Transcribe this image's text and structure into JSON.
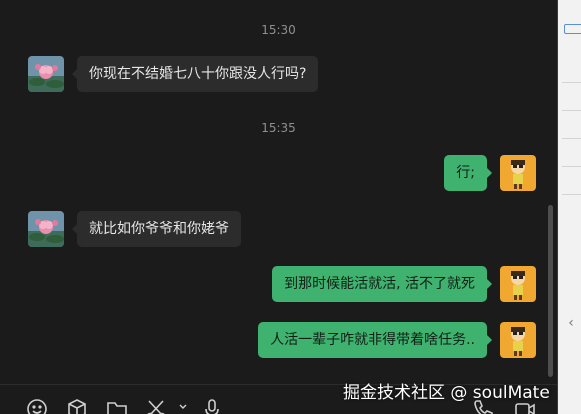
{
  "colors": {
    "background": "#1b1b1b",
    "incoming_bubble": "#2c2c2c",
    "outgoing_bubble": "#3fb270",
    "timestamp_text": "#8f8f8f"
  },
  "timestamps": [
    "15:30",
    "15:35"
  ],
  "messages": [
    {
      "side": "left",
      "text": "你现在不结婚七八十你跟没人行吗?",
      "avatar": "lotus-avatar"
    },
    {
      "side": "right",
      "text": "行;",
      "avatar": "cartoon-avatar"
    },
    {
      "side": "left",
      "text": "就比如你爷爷和你姥爷",
      "avatar": "lotus-avatar"
    },
    {
      "side": "right",
      "text": "到那时候能活就活, 活不了就死",
      "avatar": "cartoon-avatar"
    },
    {
      "side": "right",
      "text": "人活一辈子咋就非得带着啥任务..",
      "avatar": "cartoon-avatar"
    }
  ],
  "toolbar": {
    "icons": [
      "emoji-icon",
      "cube-icon",
      "folder-icon",
      "scissors-icon",
      "chevron-down-icon",
      "microphone-icon",
      "phone-icon",
      "video-icon"
    ]
  },
  "watermark": "掘金技术社区 @ soulMate"
}
